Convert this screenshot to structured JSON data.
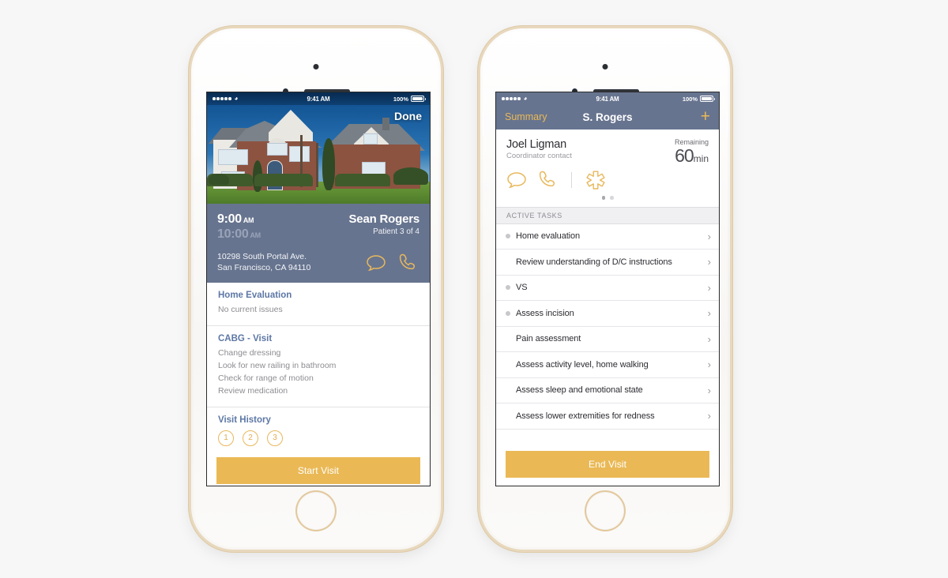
{
  "theme": {
    "gold": "#eab956",
    "slate": "#67748f",
    "heading_blue": "#5d77a5"
  },
  "phones": {
    "left": {
      "status_bar": {
        "time": "9:41 AM",
        "battery_pct": "100%",
        "signal_dots": 5,
        "wifi_icon": "wifi-icon"
      },
      "photo": {
        "alt": "patient home exterior",
        "done_label": "Done"
      },
      "info": {
        "time_start": "9:00",
        "time_start_suffix": "AM",
        "time_end": "10:00",
        "time_end_suffix": "AM",
        "patient_name": "Sean Rogers",
        "patient_meta": "Patient  3 of 4",
        "address_line1": "10298 South Portal Ave.",
        "address_line2": "San Francisco, CA 94110",
        "icons": [
          "message-icon",
          "phone-icon"
        ]
      },
      "sections": [
        {
          "title": "Home Evaluation",
          "items": [
            "No current issues"
          ]
        },
        {
          "title": "CABG - Visit",
          "items": [
            "Change dressing",
            "Look for new railing in bathroom",
            "Check for range of motion",
            "Review medication"
          ]
        }
      ],
      "visit_history": {
        "title": "Visit History",
        "entries": [
          "1",
          "2",
          "3"
        ]
      },
      "cta": "Start Visit"
    },
    "right": {
      "status_bar": {
        "time": "9:41 AM",
        "battery_pct": "100%",
        "signal_dots": 5,
        "wifi_icon": "wifi-icon"
      },
      "nav": {
        "back_label": "Summary",
        "title": "S. Rogers",
        "add_label": "+"
      },
      "contact": {
        "name": "Joel Ligman",
        "role": "Coordinator contact",
        "icons": [
          "message-icon",
          "phone-icon",
          "medical-asterisk-icon"
        ],
        "remaining_label": "Remaining",
        "remaining_value": "60",
        "remaining_unit": "min"
      },
      "pager": {
        "count": 2,
        "active": 0
      },
      "list_header": "ACTIVE TASKS",
      "tasks": [
        {
          "label": "Home evaluation",
          "bullet": true
        },
        {
          "label": "Review understanding of D/C instructions",
          "bullet": false
        },
        {
          "label": "VS",
          "bullet": true
        },
        {
          "label": "Assess incision",
          "bullet": true
        },
        {
          "label": "Pain assessment",
          "bullet": false
        },
        {
          "label": "Assess activity level, home walking",
          "bullet": false
        },
        {
          "label": "Assess sleep and emotional state",
          "bullet": false
        },
        {
          "label": "Assess lower extremities for redness",
          "bullet": false
        }
      ],
      "cta": "End Visit"
    }
  }
}
